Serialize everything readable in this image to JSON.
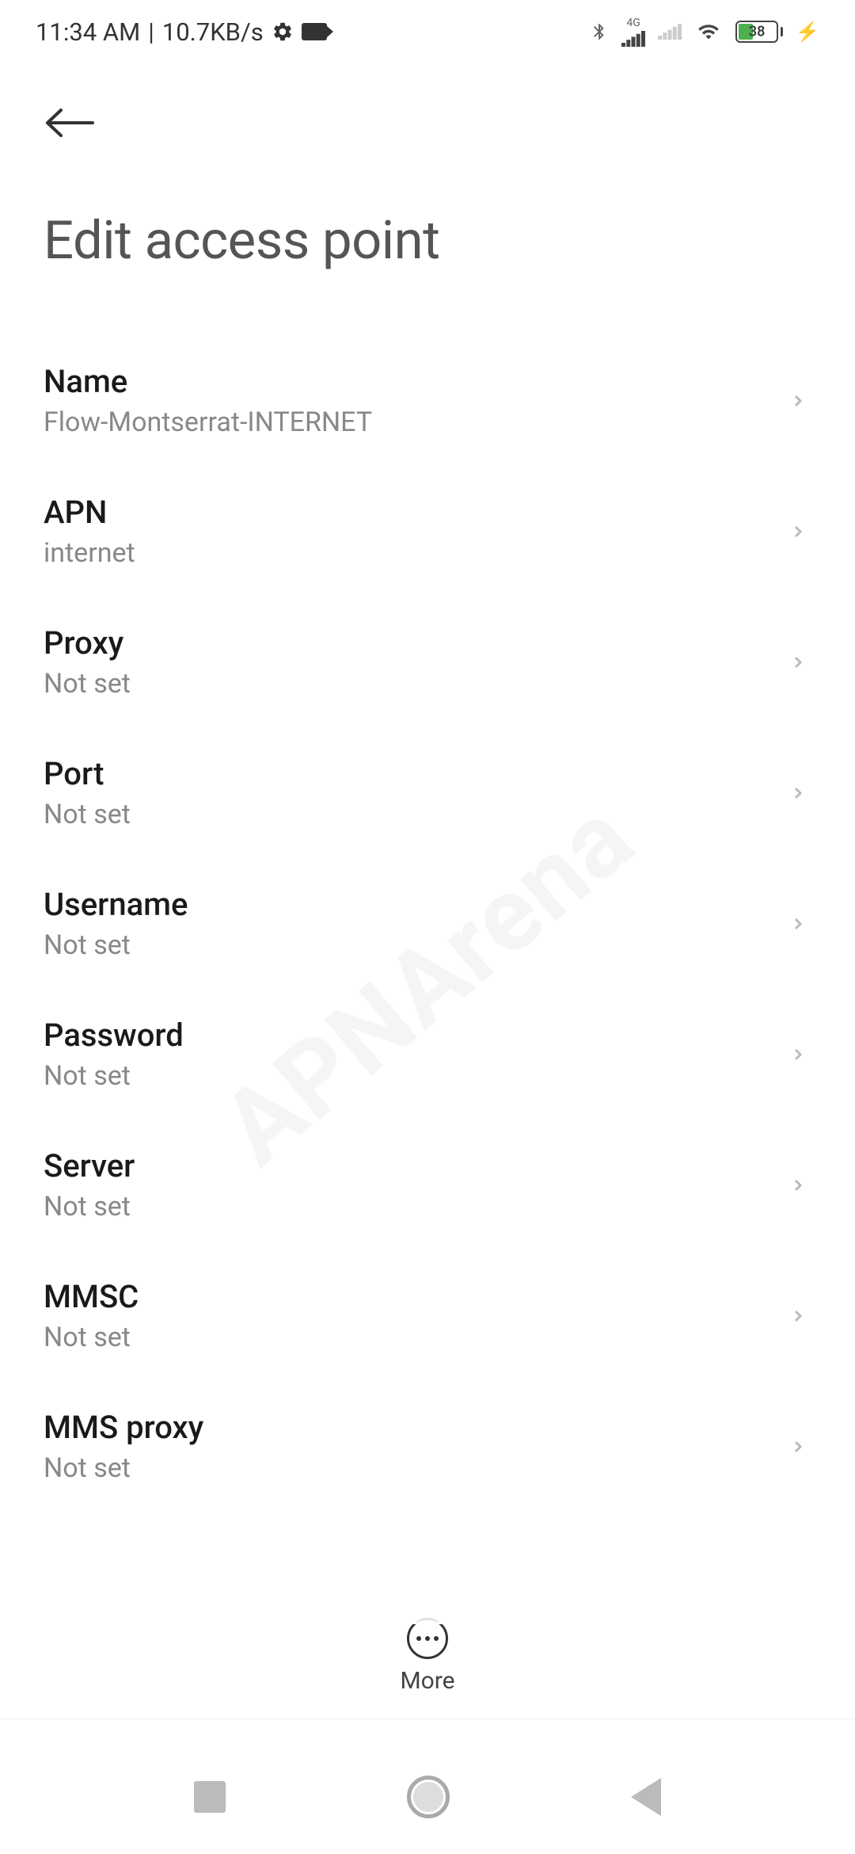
{
  "status_bar": {
    "time": "11:34 AM",
    "data_rate": "10.7KB/s",
    "network_type": "4G",
    "battery_pct": "38"
  },
  "header": {
    "title": "Edit access point"
  },
  "items": [
    {
      "label": "Name",
      "value": "Flow-Montserrat-INTERNET"
    },
    {
      "label": "APN",
      "value": "internet"
    },
    {
      "label": "Proxy",
      "value": "Not set"
    },
    {
      "label": "Port",
      "value": "Not set"
    },
    {
      "label": "Username",
      "value": "Not set"
    },
    {
      "label": "Password",
      "value": "Not set"
    },
    {
      "label": "Server",
      "value": "Not set"
    },
    {
      "label": "MMSC",
      "value": "Not set"
    },
    {
      "label": "MMS proxy",
      "value": "Not set"
    }
  ],
  "bottom_action": {
    "label": "More"
  },
  "watermark": "APNArena"
}
